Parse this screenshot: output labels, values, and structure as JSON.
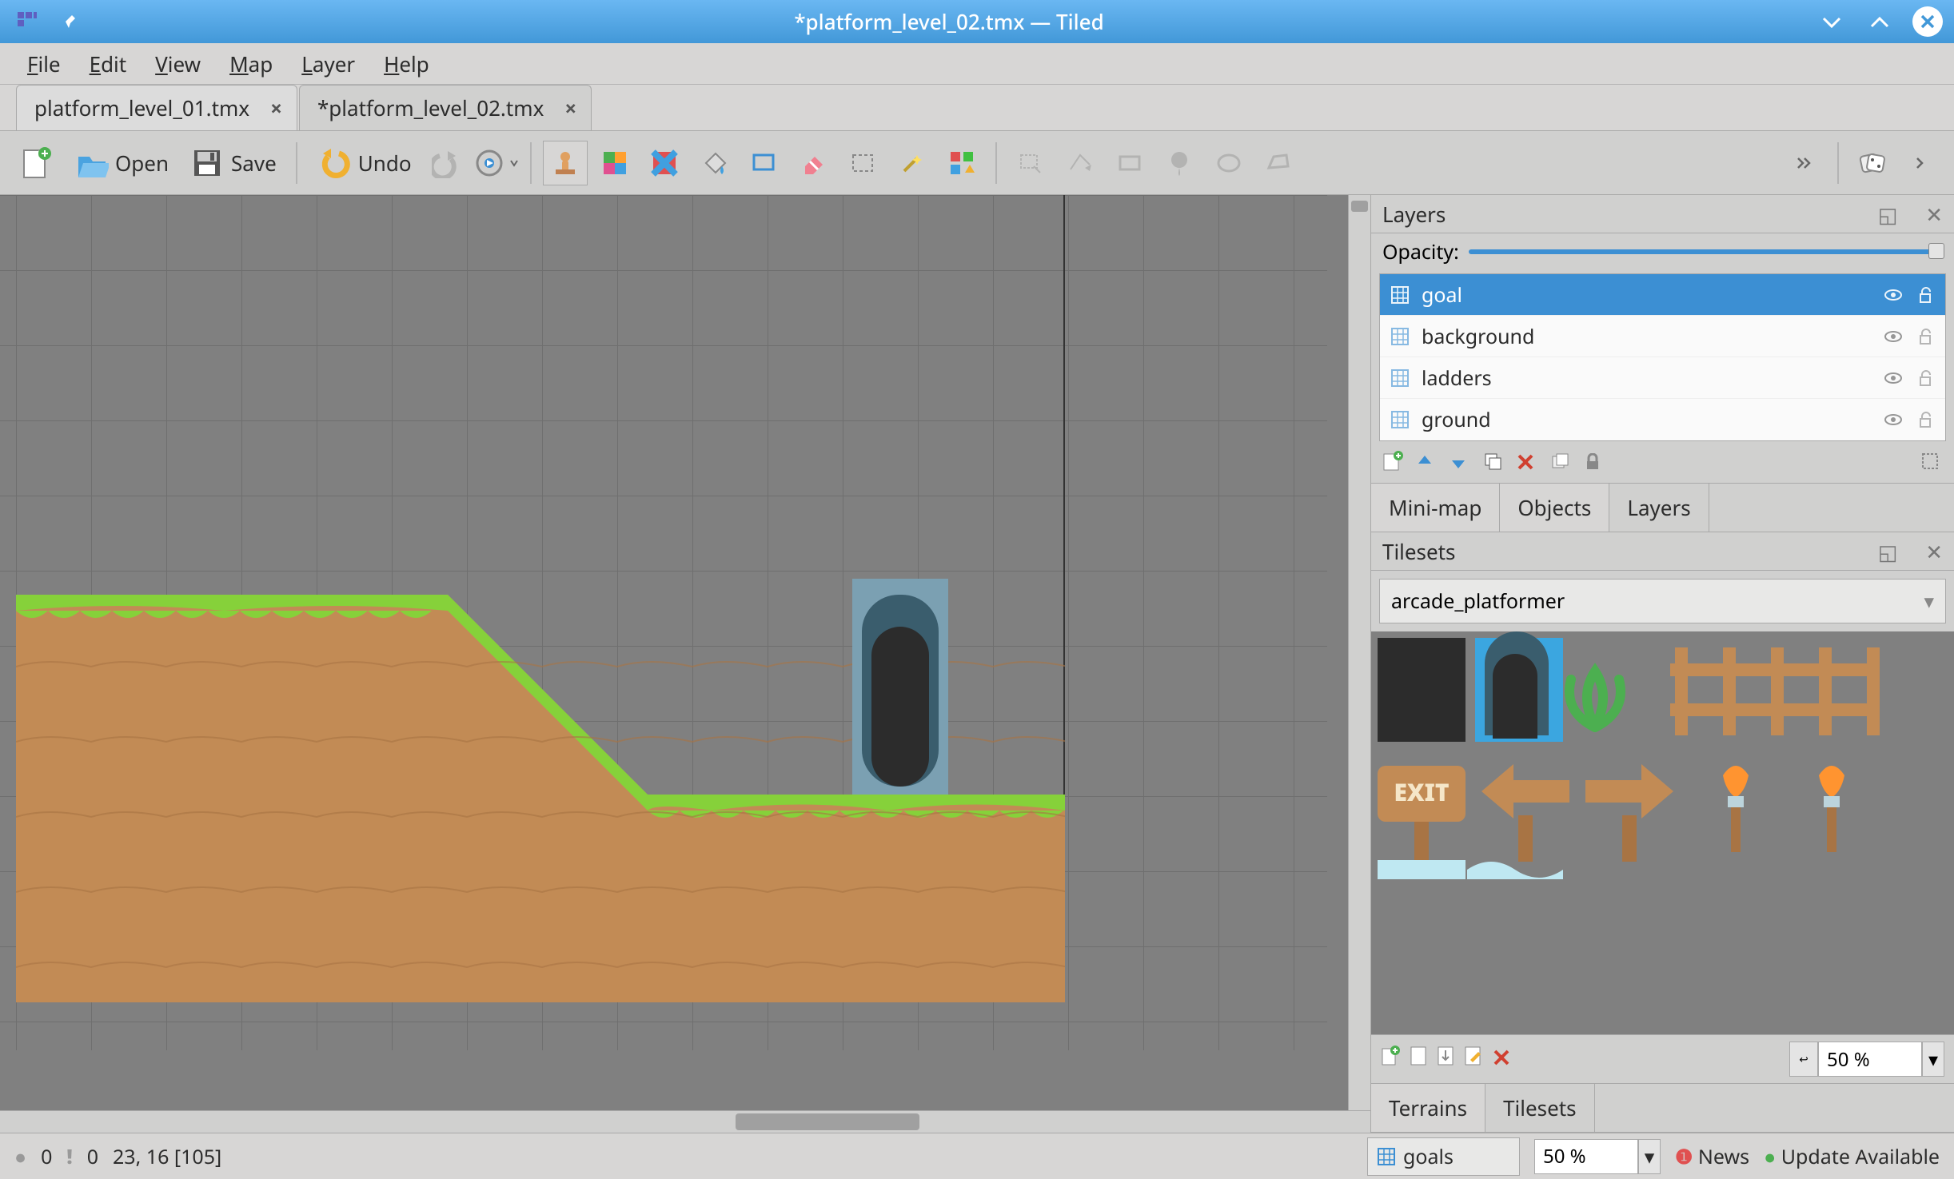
{
  "window": {
    "title": "*platform_level_02.tmx — Tiled"
  },
  "menu": {
    "file": "File",
    "edit": "Edit",
    "view": "View",
    "map": "Map",
    "layer": "Layer",
    "help": "Help"
  },
  "tabs": [
    {
      "label": "platform_level_01.tmx",
      "active": false
    },
    {
      "label": "*platform_level_02.tmx",
      "active": true
    }
  ],
  "toolbar": {
    "open": "Open",
    "save": "Save",
    "undo": "Undo"
  },
  "layers_panel": {
    "title": "Layers",
    "opacity_label": "Opacity:",
    "layers": [
      {
        "name": "goal",
        "selected": true
      },
      {
        "name": "background",
        "selected": false
      },
      {
        "name": "ladders",
        "selected": false
      },
      {
        "name": "ground",
        "selected": false
      }
    ],
    "tabs": {
      "minimap": "Mini-map",
      "objects": "Objects",
      "layers": "Layers"
    }
  },
  "tilesets_panel": {
    "title": "Tilesets",
    "selected": "arcade_platformer",
    "zoom": "50 %",
    "tabs": {
      "terrains": "Terrains",
      "tilesets": "Tilesets"
    }
  },
  "statusbar": {
    "errors": "0",
    "warnings": "0",
    "coords": "23, 16 [105]",
    "layer_dropdown": "goals",
    "zoom": "50 %",
    "news": "News",
    "update": "Update Available"
  },
  "colors": {
    "accent": "#3c8fd3",
    "titlebar1": "#6ab7f2",
    "titlebar2": "#4298d8",
    "panel": "#d0d0cf",
    "grass": "#86d13a",
    "dirt": "#c28b55"
  }
}
